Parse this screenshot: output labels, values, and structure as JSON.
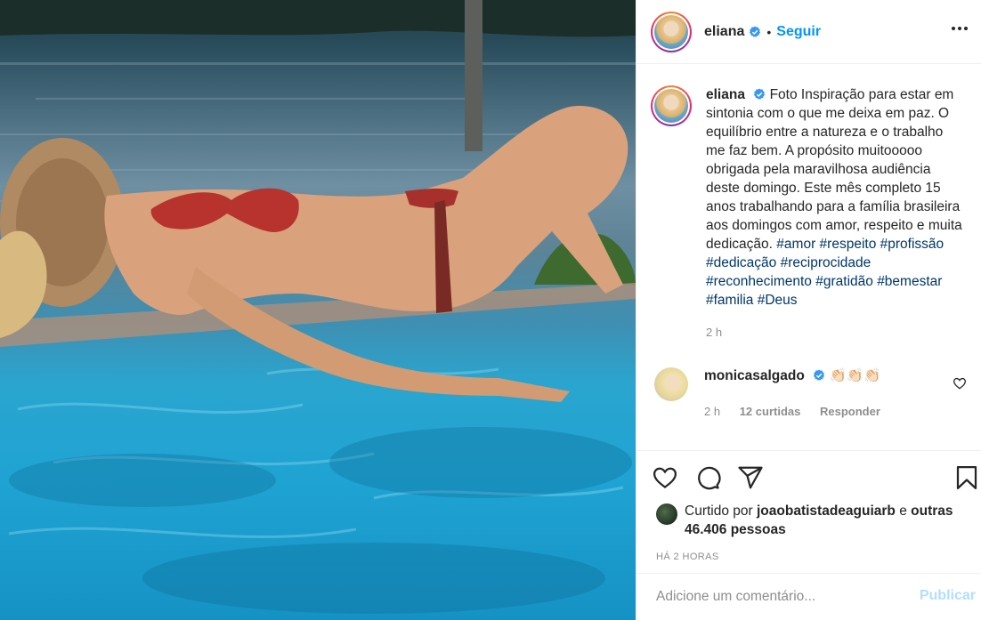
{
  "post": {
    "author": "eliana",
    "follow_label": "Seguir",
    "dot": "•",
    "caption_text": "Foto Inspiração para estar em sintonia com o que me deixa em paz. O equilíbrio entre a natureza e o trabalho me faz bem. A propósito muitooooo obrigada pela maravilhosa audiência deste domingo. Este mês completo 15 anos trabalhando para a família brasileira aos domingos com amor, respeito e muita dedicação.",
    "hashtags": [
      "#amor",
      "#respeito",
      "#profissão",
      "#dedicação",
      "#reciprocidade",
      "#reconhecimento",
      "#gratidão",
      "#bemestar",
      "#familia",
      "#Deus"
    ],
    "caption_time": "2 h"
  },
  "comment": {
    "user": "monicasalgado",
    "text": "👏🏻👏🏻👏🏻",
    "time": "2 h",
    "likes": "12 curtidas",
    "reply": "Responder"
  },
  "likes": {
    "prefix": "Curtido por",
    "user": "joaobatistadeaguiarb",
    "connector": "e",
    "others": "outras 46.406 pessoas"
  },
  "timestamp": "HÁ 2 HORAS",
  "add_comment": {
    "placeholder": "Adicione um comentário...",
    "publish_label": "Publicar"
  },
  "icons": {
    "more": "more-options-icon",
    "verified": "verified-badge-icon",
    "like": "heart-icon",
    "comment": "comment-bubble-icon",
    "share": "paper-plane-icon",
    "save": "bookmark-icon"
  },
  "colors": {
    "accent": "#0095f6",
    "publish_disabled": "#b2dffc",
    "hashtag": "#00376b",
    "muted": "#8e8e8e",
    "verified": "#3897f0"
  }
}
